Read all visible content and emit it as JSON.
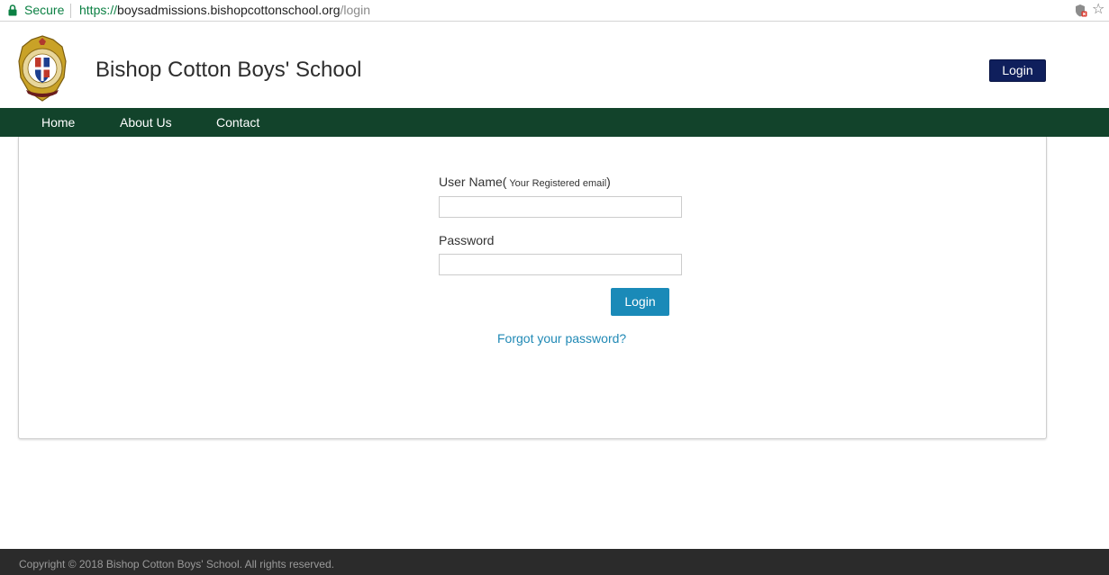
{
  "browser": {
    "secure_label": "Secure",
    "url_scheme": "https://",
    "url_host": "boysadmissions.bishopcottonschool.org",
    "url_path": "/login"
  },
  "header": {
    "title": "Bishop Cotton Boys' School",
    "login_label": "Login"
  },
  "nav": {
    "items": [
      {
        "label": "Home"
      },
      {
        "label": "About Us"
      },
      {
        "label": "Contact"
      }
    ]
  },
  "form": {
    "username_label": "User Name(",
    "username_hint": " Your Registered email",
    "username_label_close": ")",
    "username_value": "",
    "password_label": "Password",
    "password_value": "",
    "login_label": "Login",
    "forgot_label": "Forgot your password?"
  },
  "footer": {
    "text": "Copyright © 2018 Bishop Cotton Boys' School. All rights reserved."
  },
  "colors": {
    "nav_bg": "#12432b",
    "header_button_bg": "#0f1f5c",
    "login_button_bg": "#1a8ab8",
    "link": "#2089b5",
    "footer_bg": "#2b2b2b",
    "secure_green": "#0b8043"
  },
  "icons": {
    "lock": "lock-icon",
    "extension": "shield-extension-icon",
    "bookmark": "star-icon",
    "logo": "school-crest-logo"
  }
}
